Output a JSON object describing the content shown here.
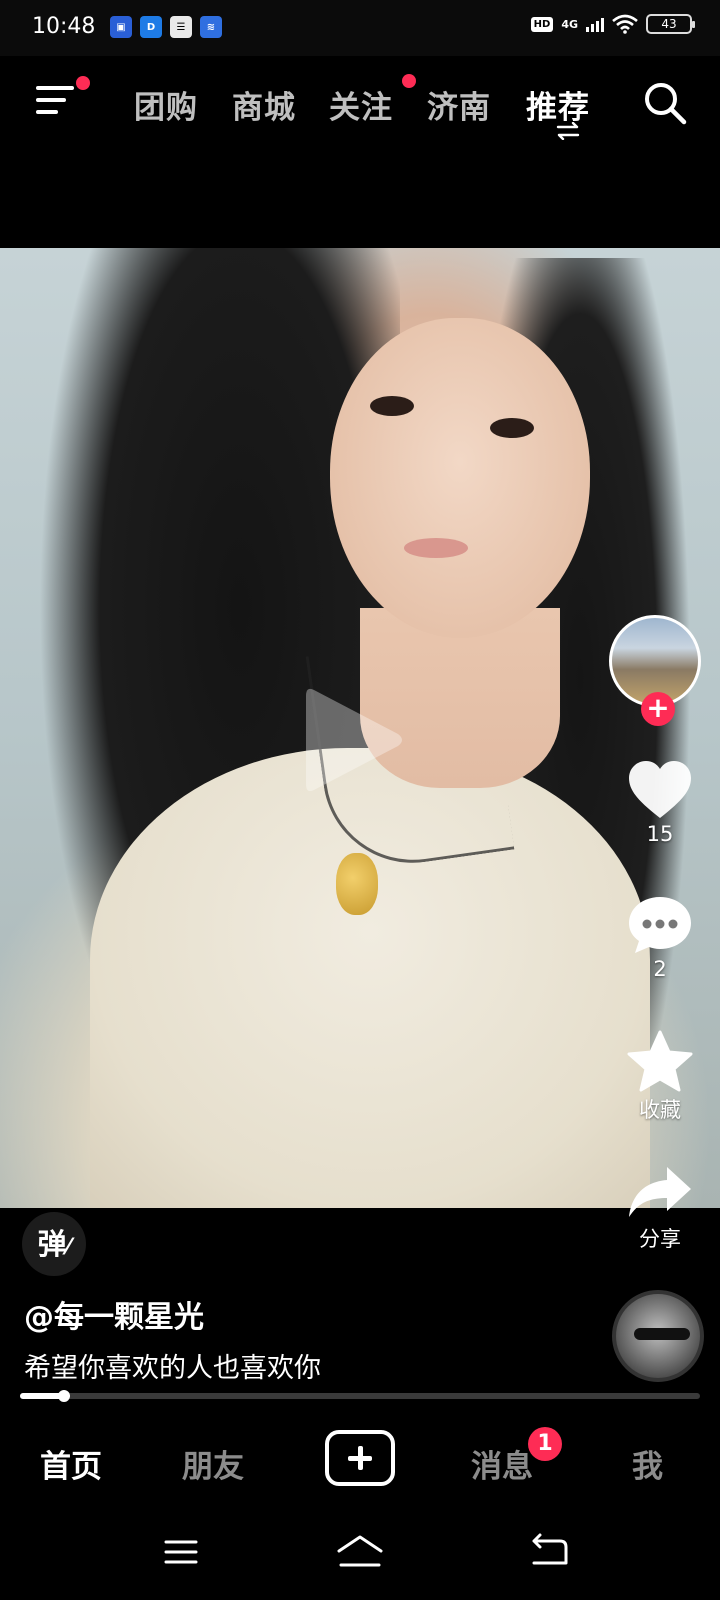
{
  "status_bar": {
    "time": "10:48",
    "app_icons": [
      "app-icon-1",
      "app-icon-2",
      "app-icon-3",
      "app-icon-4"
    ],
    "hd_label": "HD",
    "network_label": "4G",
    "battery": "43"
  },
  "top_nav": {
    "tabs": [
      {
        "label": "团购",
        "active": false
      },
      {
        "label": "商城",
        "active": false
      },
      {
        "label": "关注",
        "active": false
      },
      {
        "label": "济南",
        "active": false
      },
      {
        "label": "推荐",
        "active": true
      }
    ]
  },
  "actions": {
    "likes": "15",
    "comments": "2",
    "favorite_label": "收藏",
    "share_label": "分享"
  },
  "danmaku_label": "弹",
  "post": {
    "author": "@每一颗星光",
    "caption": "希望你喜欢的人也喜欢你"
  },
  "progress": 0.065,
  "bottom_tabs": {
    "home": "首页",
    "friends": "朋友",
    "messages": "消息",
    "messages_badge": "1",
    "me": "我"
  },
  "colors": {
    "accent": "#fe2c55",
    "background": "#000000"
  }
}
